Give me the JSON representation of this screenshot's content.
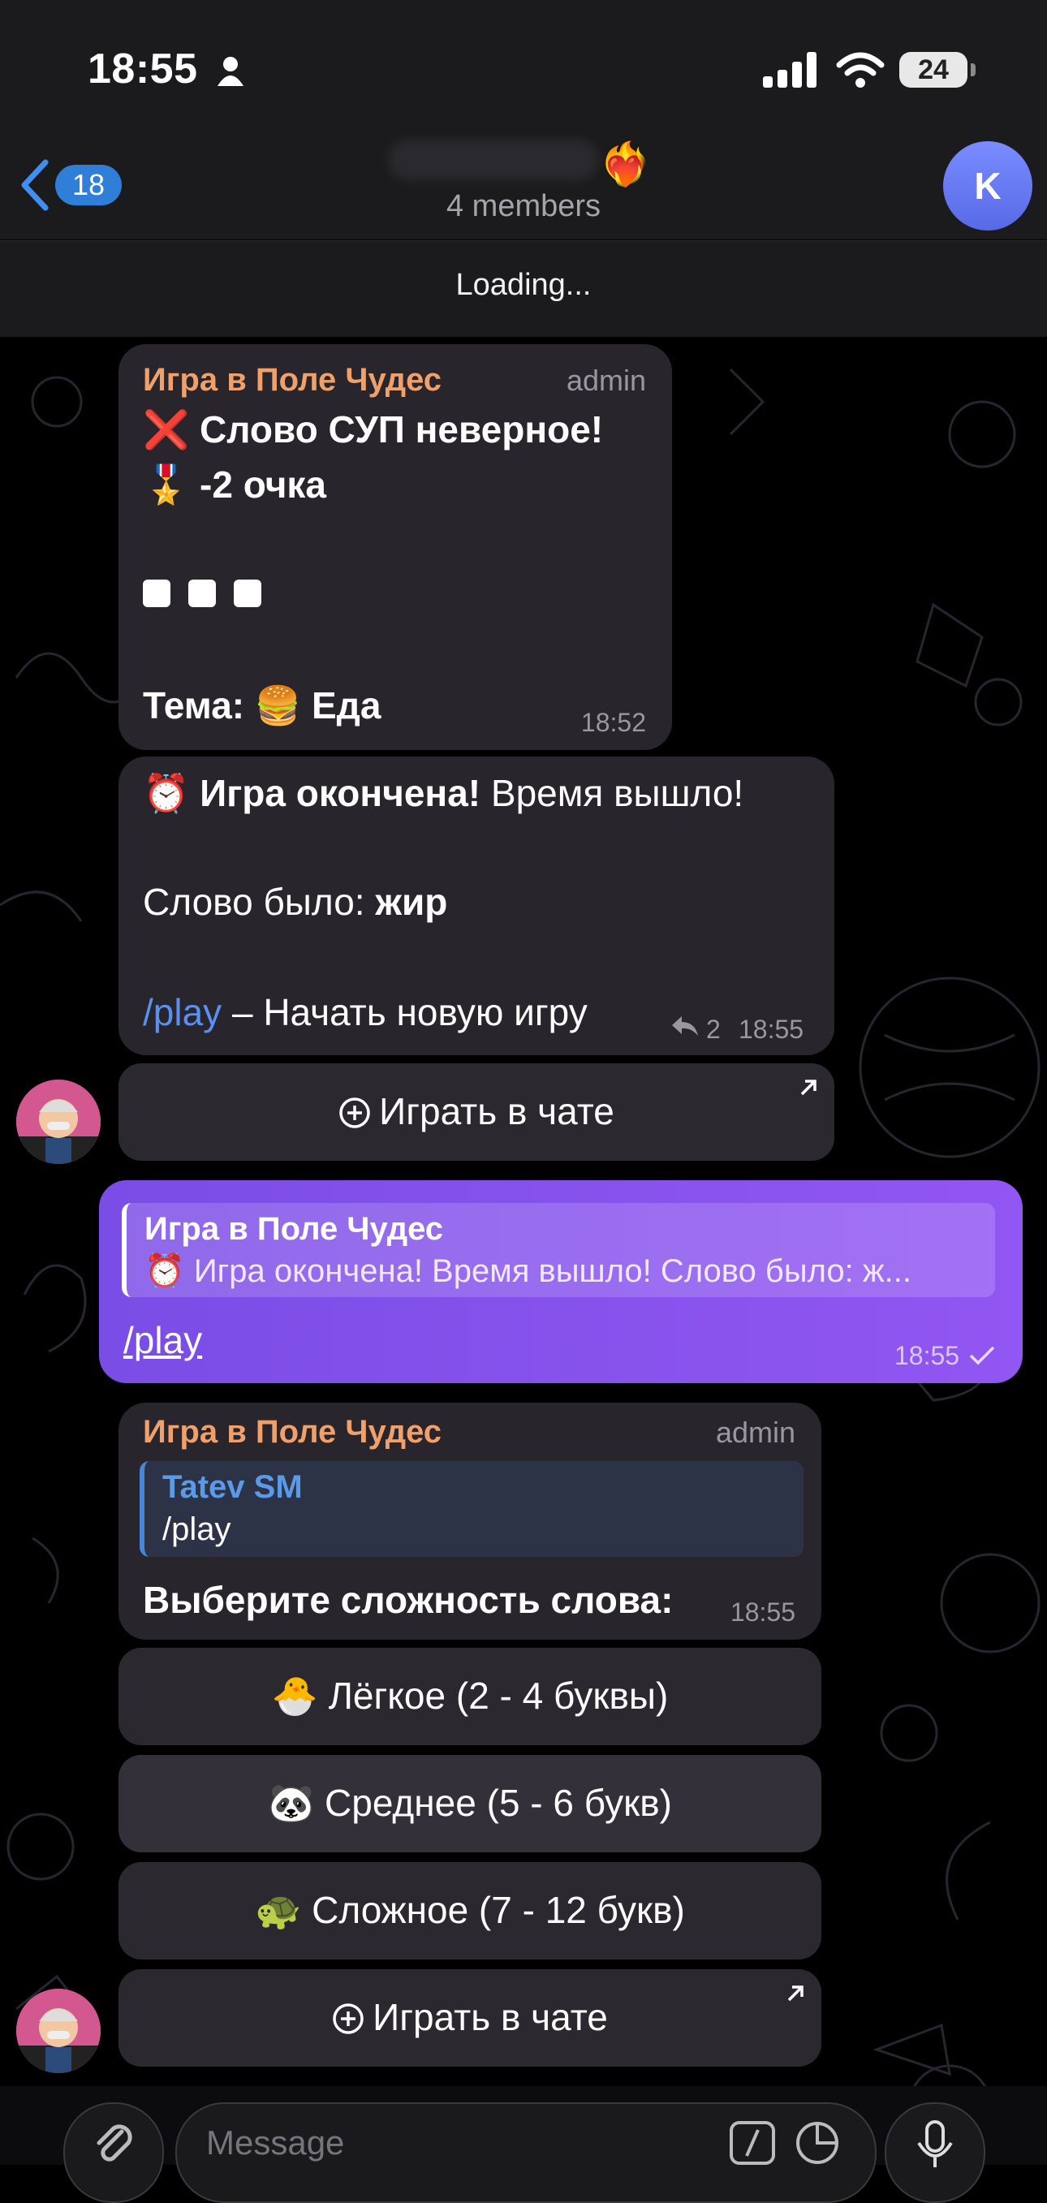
{
  "status_bar": {
    "time": "18:55",
    "battery": "24",
    "icons": [
      "person-icon",
      "cellular-signal-icon",
      "wifi-icon",
      "battery-icon"
    ]
  },
  "header": {
    "back_count": "18",
    "title_emoji": "❤️‍🔥",
    "members": "4 members",
    "avatar_letter": "K"
  },
  "loading_bar": {
    "text": "Loading..."
  },
  "messages": [
    {
      "sender": "Игра в Поле Чудес",
      "role": "admin",
      "line1": "❌ Слово СУП неверное!",
      "line2": "🎖️ -2 очка",
      "theme_label": "Тема: 🍔 Еда",
      "time": "18:52"
    },
    {
      "alarm": "⏰",
      "title_bold": "Игра окончена!",
      "title_rest": " Время вышло!",
      "word_label": "Слово было: ",
      "word_bold": "жир",
      "command": "/play",
      "command_rest": " – Начать новую игру",
      "replies": "2",
      "time": "18:55",
      "button": "Играть в чате"
    },
    {
      "reply_sender": "Игра в Поле Чудес",
      "reply_text": "⏰ Игра окончена! Время вышло! Слово было: ж...",
      "text": "/play",
      "time": "18:55"
    },
    {
      "sender": "Игра в Поле Чудес",
      "role": "admin",
      "reply_sender": "Tatev SM",
      "reply_text": "/play",
      "text": "Выберите сложность слова:",
      "time": "18:55",
      "buttons": [
        "🐣 Лёгкое (2 - 4 буквы)",
        "🐼 Среднее (5 - 6 букв)",
        "🐢 Сложное (7 - 12 букв)"
      ],
      "chat_button": "Играть в чате"
    }
  ],
  "composer": {
    "placeholder": "Message"
  },
  "colors": {
    "accent_blue": "#2f7fd8",
    "sender_orange": "#f0a06a",
    "outgoing_bubble": "#8a52ee",
    "link": "#5b8ff0"
  }
}
